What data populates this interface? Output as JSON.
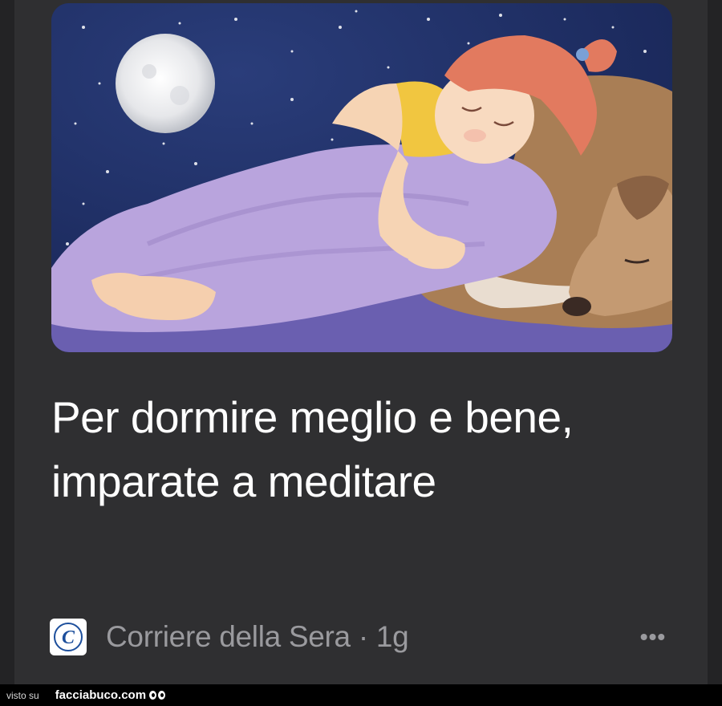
{
  "article": {
    "image_alt": "Bambina che dorme abbracciata a un cane sotto la luna",
    "title": "Per dormire meglio e bene, imparate a meditare",
    "source": "Corriere della Sera",
    "separator": "·",
    "age": "1g",
    "logo_letter": "C",
    "more_label": "•••"
  },
  "footer": {
    "prefix": "visto su",
    "site": "facciabuco.com"
  },
  "colors": {
    "background": "#232325",
    "card": "#2f2f31",
    "title": "#ffffff",
    "meta": "#9a9a9e",
    "logo_blue": "#1d4f9c"
  }
}
